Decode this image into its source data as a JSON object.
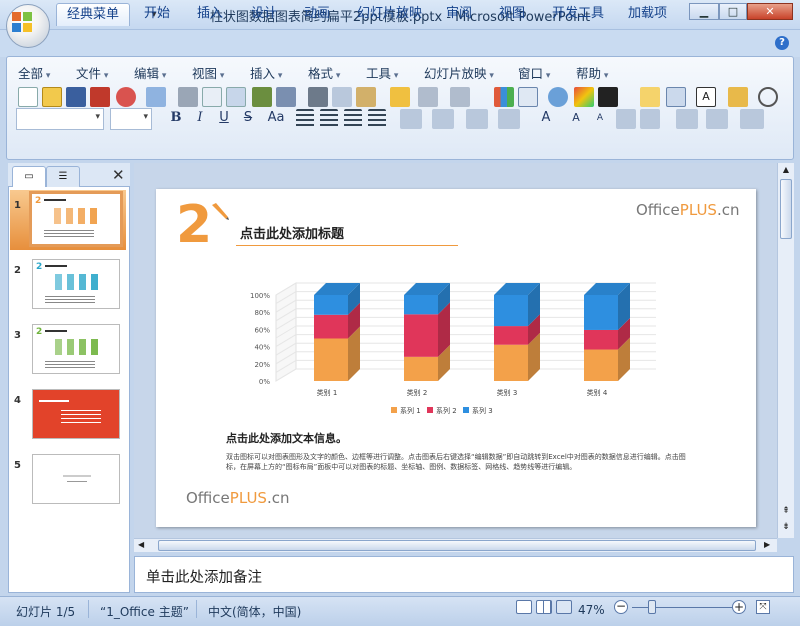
{
  "window": {
    "title": "柱状图数据图表简约扁平2ppt模板.pptx - Microsoft PowerPoint",
    "min": "▁",
    "max": "□",
    "close": "✕"
  },
  "ribbon_tabs": [
    "经典菜单",
    "开始",
    "插入",
    "设计",
    "动画",
    "幻灯片放映",
    "审阅",
    "视图",
    "开发工具",
    "加载项"
  ],
  "menus": [
    "全部",
    "文件",
    "编辑",
    "视图",
    "插入",
    "格式",
    "工具",
    "幻灯片放映",
    "窗口",
    "帮助"
  ],
  "format": {
    "bold": "B",
    "italic": "I",
    "underline": "U",
    "strike": "S",
    "case": "Aa"
  },
  "panel": {
    "close": "✕"
  },
  "thumbnails": [
    {
      "num": "1",
      "accent": "#f09a3e",
      "style": "chart-orange"
    },
    {
      "num": "2",
      "accent": "#2aa6c9",
      "style": "chart-blue"
    },
    {
      "num": "3",
      "accent": "#6fb33c",
      "style": "chart-green"
    },
    {
      "num": "4",
      "accent": "#e2432a",
      "style": "red-slide"
    },
    {
      "num": "5",
      "accent": "#ffffff",
      "style": "blank"
    }
  ],
  "slide": {
    "number": "2",
    "brand": {
      "prefix": "Office",
      "highlight": "PLUS",
      "suffix": ".cn"
    },
    "title": "点击此处添加标题",
    "subtitle": "点击此处添加文本信息。",
    "body": "双击图标可以对图表图形及文字的颜色、边框等进行调整。点击图表后右键选择“编辑数据”即自动跳转到Excel中对图表的数据信息进行编辑。点击图标，在屏幕上方的“图标布局”面板中可以对图表的标题、坐标轴、图例、数据标签、网格线、趋势线等进行编辑。",
    "footer_brand": {
      "prefix": "Office",
      "highlight": "PLUS",
      "suffix": ".cn"
    }
  },
  "chart_data": {
    "type": "bar",
    "stacked": "100%",
    "categories": [
      "类别 1",
      "类别 2",
      "类别 3",
      "类别 4"
    ],
    "series": [
      {
        "name": "系列 1",
        "color": "#f3a14a",
        "values": [
          4.3,
          2.5,
          3.5,
          4.5
        ]
      },
      {
        "name": "系列 2",
        "color": "#e0365a",
        "values": [
          2.4,
          4.4,
          1.8,
          2.8
        ]
      },
      {
        "name": "系列 3",
        "color": "#2e8fe0",
        "values": [
          2.0,
          2.0,
          3.0,
          5.0
        ]
      }
    ],
    "yticks": [
      "0%",
      "10%",
      "20%",
      "30%",
      "40%",
      "50%",
      "60%",
      "70%",
      "80%",
      "90%",
      "100%"
    ],
    "ylim": [
      0,
      1
    ],
    "legend": "bottom",
    "grid": true
  },
  "notes": {
    "placeholder": "单击此处添加备注"
  },
  "status": {
    "slide": "幻灯片 1/5",
    "theme": "“1_Office 主题”",
    "lang": "中文(简体，中国)",
    "zoom": "47%"
  }
}
